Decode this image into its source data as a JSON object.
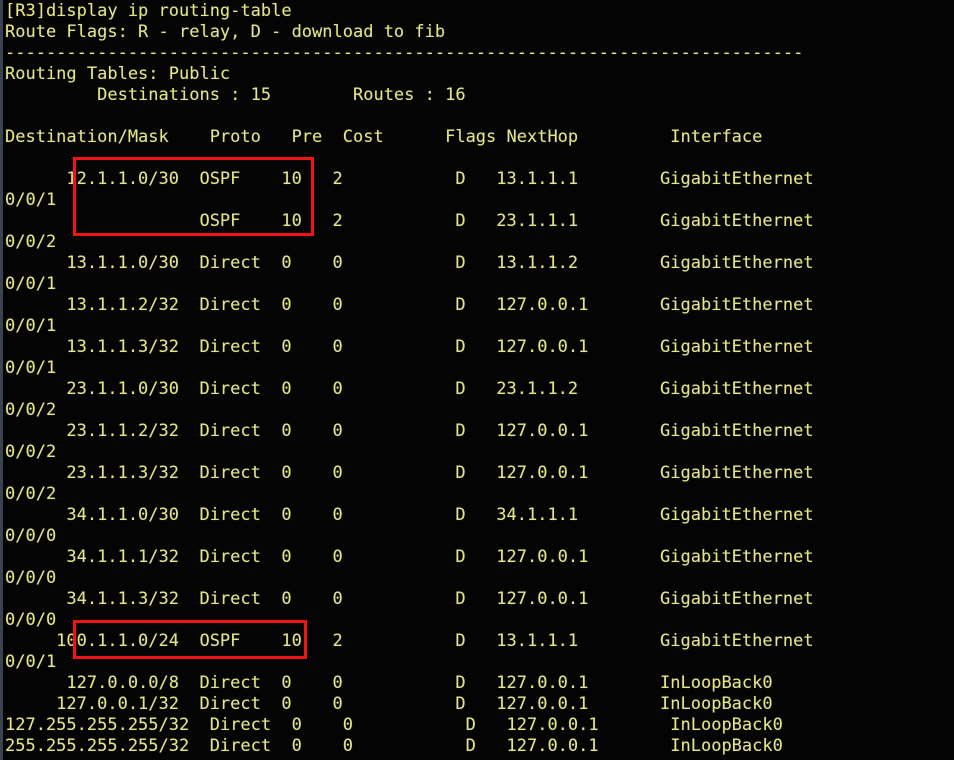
{
  "terminal": {
    "prompt": "[R3]",
    "command": "display ip routing-table",
    "flags_legend": "Route Flags: R - relay, D - download to fib",
    "separator": "--------------------------------------------------------------------------------",
    "table_scope_label": "Routing Tables: Public",
    "summary_line": "         Destinations : 15        Routes : 16",
    "destinations_count": "15",
    "routes_count": "16",
    "colors": {
      "background": "#040404",
      "text": "#e4e48c",
      "highlight_box": "#f01414",
      "window_border": "#3a4450"
    },
    "columns": [
      "Destination/Mask",
      "Proto",
      "Pre",
      "Cost",
      "Flags",
      "NextHop",
      "Interface"
    ],
    "header_line": "Destination/Mask    Proto   Pre  Cost      Flags NextHop         Interface",
    "routes": [
      {
        "destination": "12.1.1.0/30",
        "proto": "OSPF",
        "pre": "10",
        "cost": "2",
        "flags": "D",
        "nexthop": "13.1.1.1",
        "interface": "GigabitEthernet0/0/1",
        "highlighted": true
      },
      {
        "destination": "",
        "proto": "OSPF",
        "pre": "10",
        "cost": "2",
        "flags": "D",
        "nexthop": "23.1.1.1",
        "interface": "GigabitEthernet0/0/2",
        "highlighted": true
      },
      {
        "destination": "13.1.1.0/30",
        "proto": "Direct",
        "pre": "0",
        "cost": "0",
        "flags": "D",
        "nexthop": "13.1.1.2",
        "interface": "GigabitEthernet0/0/1",
        "highlighted": false
      },
      {
        "destination": "13.1.1.2/32",
        "proto": "Direct",
        "pre": "0",
        "cost": "0",
        "flags": "D",
        "nexthop": "127.0.0.1",
        "interface": "GigabitEthernet0/0/1",
        "highlighted": false
      },
      {
        "destination": "13.1.1.3/32",
        "proto": "Direct",
        "pre": "0",
        "cost": "0",
        "flags": "D",
        "nexthop": "127.0.0.1",
        "interface": "GigabitEthernet0/0/1",
        "highlighted": false
      },
      {
        "destination": "23.1.1.0/30",
        "proto": "Direct",
        "pre": "0",
        "cost": "0",
        "flags": "D",
        "nexthop": "23.1.1.2",
        "interface": "GigabitEthernet0/0/2",
        "highlighted": false
      },
      {
        "destination": "23.1.1.2/32",
        "proto": "Direct",
        "pre": "0",
        "cost": "0",
        "flags": "D",
        "nexthop": "127.0.0.1",
        "interface": "GigabitEthernet0/0/2",
        "highlighted": false
      },
      {
        "destination": "23.1.1.3/32",
        "proto": "Direct",
        "pre": "0",
        "cost": "0",
        "flags": "D",
        "nexthop": "127.0.0.1",
        "interface": "GigabitEthernet0/0/2",
        "highlighted": false
      },
      {
        "destination": "34.1.1.0/30",
        "proto": "Direct",
        "pre": "0",
        "cost": "0",
        "flags": "D",
        "nexthop": "34.1.1.1",
        "interface": "GigabitEthernet0/0/0",
        "highlighted": false
      },
      {
        "destination": "34.1.1.1/32",
        "proto": "Direct",
        "pre": "0",
        "cost": "0",
        "flags": "D",
        "nexthop": "127.0.0.1",
        "interface": "GigabitEthernet0/0/0",
        "highlighted": false
      },
      {
        "destination": "34.1.1.3/32",
        "proto": "Direct",
        "pre": "0",
        "cost": "0",
        "flags": "D",
        "nexthop": "127.0.0.1",
        "interface": "GigabitEthernet0/0/0",
        "highlighted": false
      },
      {
        "destination": "100.1.1.0/24",
        "proto": "OSPF",
        "pre": "10",
        "cost": "2",
        "flags": "D",
        "nexthop": "13.1.1.1",
        "interface": "GigabitEthernet0/0/1",
        "highlighted": true
      },
      {
        "destination": "127.0.0.0/8",
        "proto": "Direct",
        "pre": "0",
        "cost": "0",
        "flags": "D",
        "nexthop": "127.0.0.1",
        "interface": "InLoopBack0",
        "highlighted": false
      },
      {
        "destination": "127.0.0.1/32",
        "proto": "Direct",
        "pre": "0",
        "cost": "0",
        "flags": "D",
        "nexthop": "127.0.0.1",
        "interface": "InLoopBack0",
        "highlighted": false
      },
      {
        "destination": "127.255.255.255/32",
        "proto": "Direct",
        "pre": "0",
        "cost": "0",
        "flags": "D",
        "nexthop": "127.0.0.1",
        "interface": "InLoopBack0",
        "highlighted": false
      },
      {
        "destination": "255.255.255.255/32",
        "proto": "Direct",
        "pre": "0",
        "cost": "0",
        "flags": "D",
        "nexthop": "127.0.0.1",
        "interface": "InLoopBack0",
        "highlighted": false
      }
    ],
    "screen_text": "[R3]display ip routing-table\nRoute Flags: R - relay, D - download to fib\n------------------------------------------------------------------------------\nRouting Tables: Public\n         Destinations : 15        Routes : 16\n\nDestination/Mask    Proto   Pre  Cost      Flags NextHop         Interface\n\n      12.1.1.0/30  OSPF    10   2           D   13.1.1.1        GigabitEthernet\n0/0/1\n                   OSPF    10   2           D   23.1.1.1        GigabitEthernet\n0/0/2\n      13.1.1.0/30  Direct  0    0           D   13.1.1.2        GigabitEthernet\n0/0/1\n      13.1.1.2/32  Direct  0    0           D   127.0.0.1       GigabitEthernet\n0/0/1\n      13.1.1.3/32  Direct  0    0           D   127.0.0.1       GigabitEthernet\n0/0/1\n      23.1.1.0/30  Direct  0    0           D   23.1.1.2        GigabitEthernet\n0/0/2\n      23.1.1.2/32  Direct  0    0           D   127.0.0.1       GigabitEthernet\n0/0/2\n      23.1.1.3/32  Direct  0    0           D   127.0.0.1       GigabitEthernet\n0/0/2\n      34.1.1.0/30  Direct  0    0           D   34.1.1.1        GigabitEthernet\n0/0/0\n      34.1.1.1/32  Direct  0    0           D   127.0.0.1       GigabitEthernet\n0/0/0\n      34.1.1.3/32  Direct  0    0           D   127.0.0.1       GigabitEthernet\n0/0/0\n     100.1.1.0/24  OSPF    10   2           D   13.1.1.1        GigabitEthernet\n0/0/1\n      127.0.0.0/8  Direct  0    0           D   127.0.0.1       InLoopBack0\n     127.0.0.1/32  Direct  0    0           D   127.0.0.1       InLoopBack0\n127.255.255.255/32  Direct  0    0           D   127.0.0.1       InLoopBack0\n255.255.255.255/32  Direct  0    0           D   127.0.0.1       InLoopBack0"
  }
}
